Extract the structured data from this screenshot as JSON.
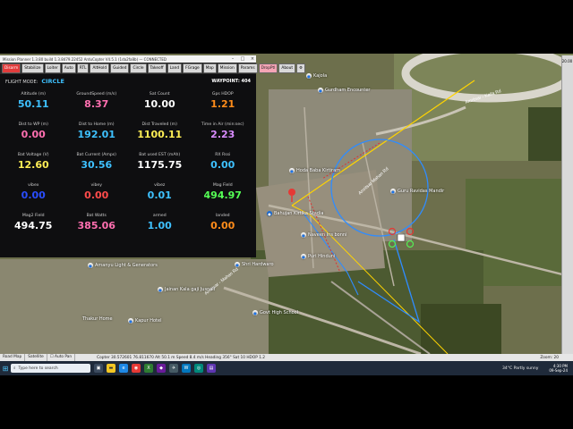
{
  "window": {
    "title": "Mission Planner 1.3.80 build 1.3.8479.22452 ArduCopter V4.5.1 (1da2fa8b) — CONNECTED"
  },
  "toolbar": {
    "buttons": [
      {
        "label": "Disarm",
        "style": "red"
      },
      {
        "label": "Stabilize",
        "style": "normal"
      },
      {
        "label": "Loiter",
        "style": "normal"
      },
      {
        "label": "Auto",
        "style": "normal"
      },
      {
        "label": "RTL",
        "style": "normal"
      },
      {
        "label": "AltHold",
        "style": "normal"
      },
      {
        "label": "Guided",
        "style": "normal"
      },
      {
        "label": "Circle",
        "style": "normal"
      },
      {
        "label": "Takeoff",
        "style": "normal"
      },
      {
        "label": "Land",
        "style": "normal"
      },
      {
        "label": "FGrage",
        "style": "normal"
      },
      {
        "label": "Map",
        "style": "normal"
      },
      {
        "label": "Mission",
        "style": "normal"
      },
      {
        "label": "Params",
        "style": "normal"
      },
      {
        "label": "DropPtl",
        "style": "pink"
      },
      {
        "label": "About",
        "style": "normal"
      },
      {
        "label": "⚙",
        "style": "normal"
      }
    ]
  },
  "flight": {
    "mode_label": "FLIGHT MODE:",
    "mode": "CIRCLE",
    "waypoint": "WAYPOINT: 404"
  },
  "telemetry": [
    {
      "label": "Altitude (m)",
      "value": "50.11",
      "color": "#3ec1ff"
    },
    {
      "label": "GroundSpeed (m/s)",
      "value": "8.37",
      "color": "#ff6fb0"
    },
    {
      "label": "Sat Count",
      "value": "10.00",
      "color": "#ffffff"
    },
    {
      "label": "Gps HDOP",
      "value": "1.21",
      "color": "#ff8c1a"
    },
    {
      "label": "Dist to WP (m)",
      "value": "0.00",
      "color": "#ff6fb0"
    },
    {
      "label": "Dist to Home (m)",
      "value": "192.01",
      "color": "#3ec1ff"
    },
    {
      "label": "Dist Traveled (m)",
      "value": "1100.11",
      "color": "#ffee55"
    },
    {
      "label": "Time in Air (min:sec)",
      "value": "2.23",
      "color": "#d98cff"
    },
    {
      "label": "Bat Voltage (V)",
      "value": "12.60",
      "color": "#ffee55"
    },
    {
      "label": "Bat Current (Amps)",
      "value": "30.56",
      "color": "#3ec1ff"
    },
    {
      "label": "Bat used EST (mAh)",
      "value": "1175.75",
      "color": "#ffffff"
    },
    {
      "label": "RX Rssi",
      "value": "0.00",
      "color": "#3ec1ff"
    },
    {
      "label": "vibex",
      "value": "0.00",
      "color": "#2a4dff"
    },
    {
      "label": "vibey",
      "value": "0.00",
      "color": "#ff4b4b"
    },
    {
      "label": "vibez",
      "value": "0.01",
      "color": "#3ec1ff"
    },
    {
      "label": "Mag Field",
      "value": "494.97",
      "color": "#55ff55"
    },
    {
      "label": "Mag2 Field",
      "value": "494.75",
      "color": "#ffffff"
    },
    {
      "label": "Bat Watts",
      "value": "385.06",
      "color": "#ff6fb0"
    },
    {
      "label": "armed",
      "value": "1.00",
      "color": "#3ec1ff"
    },
    {
      "label": "landed",
      "value": "0.00",
      "color": "#ff8c1a"
    }
  ],
  "map": {
    "zoom": "20.00",
    "places": [
      {
        "name": "Kajola"
      },
      {
        "name": "Gurdham Encounter"
      },
      {
        "name": "Hoda Baba Kirtiram"
      },
      {
        "name": "Guru Ravidas Mandir"
      },
      {
        "name": "Bahujan Kirtika Stadia"
      },
      {
        "name": "Naveen Ins bonni"
      },
      {
        "name": "Puri Hinduni"
      },
      {
        "name": "Amanyu Light & Generators"
      },
      {
        "name": "Shri Hardwaro"
      },
      {
        "name": "Jainan Kala gaji Jusnall"
      },
      {
        "name": "Govt High School"
      },
      {
        "name": "Thakur Home"
      },
      {
        "name": "Kapur Hotel"
      }
    ],
    "road_labels": [
      "Amritsar Mahan Rd",
      "Amritsar - Mahan Rd",
      "Amritsar - Kaila Rd"
    ]
  },
  "map_bar": {
    "road_map": "Road Map",
    "satellite": "Satellite",
    "auto_pan": "Auto Pan",
    "status": "Copter 30.572601 76.811670  Alt 50.1 m  Speed 8.4 m/s  Heading 356°  Sat 10  HDOP 1.2",
    "zoom": "Zoom: 20"
  },
  "taskbar": {
    "search_placeholder": "Type here to search",
    "weather": "34°C  Partly sunny",
    "time": "4:30 PM",
    "date": "09-Sep-24"
  }
}
